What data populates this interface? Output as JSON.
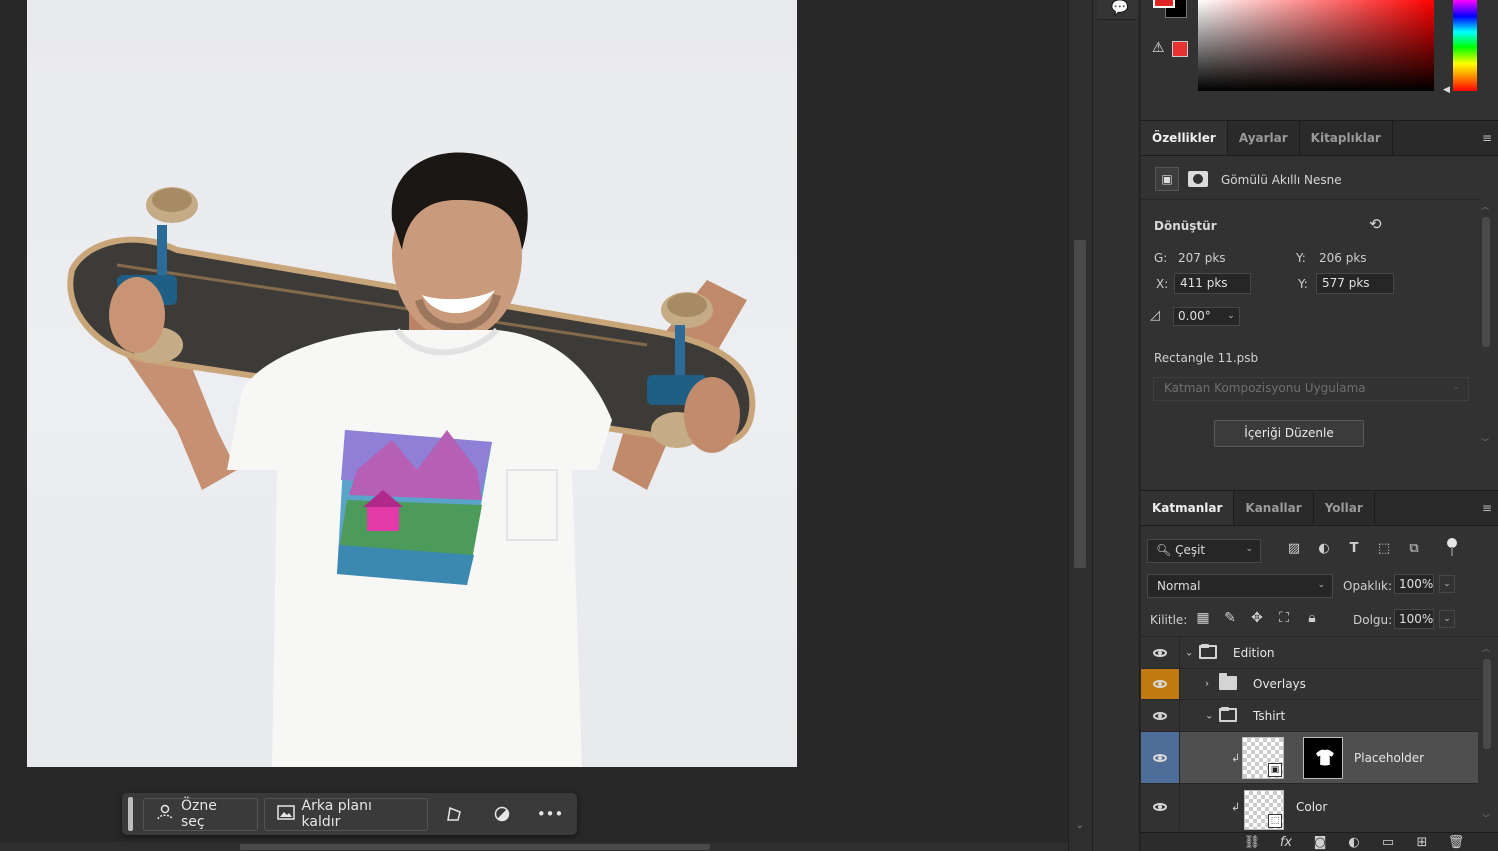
{
  "task_bar": {
    "select_subject": "Özne seç",
    "remove_background": "Arka planı kaldır"
  },
  "properties": {
    "tabs": [
      "Özellikler",
      "Ayarlar",
      "Kitaplıklar"
    ],
    "object_type": "Gömülü Akıllı Nesne",
    "transform_title": "Dönüştür",
    "width_label": "G:",
    "width_value": "207 pks",
    "height_label": "Y:",
    "height_value": "206 pks",
    "x_label": "X:",
    "x_value": "411 pks",
    "y_label": "Y:",
    "y_value": "577 pks",
    "angle_value": "0.00°",
    "file_name": "Rectangle 11.psb",
    "comp_placeholder": "Katman Kompozisyonu Uygulama",
    "edit_contents": "İçeriği Düzenle"
  },
  "layers": {
    "tabs": [
      "Katmanlar",
      "Kanallar",
      "Yollar"
    ],
    "kind_filter": "Çeşit",
    "blend_mode": "Normal",
    "opacity_label": "Opaklık:",
    "opacity_value": "100%",
    "lock_label": "Kilitle:",
    "fill_label": "Dolgu:",
    "fill_value": "100%",
    "rows": [
      {
        "name": "Edition",
        "kind": "group-open"
      },
      {
        "name": "Overlays",
        "kind": "group-closed"
      },
      {
        "name": "Tshirt",
        "kind": "group-open"
      },
      {
        "name": "Placeholder",
        "kind": "smart-object"
      },
      {
        "name": "Color",
        "kind": "layer"
      }
    ]
  },
  "colors": {
    "foreground": "#e02424",
    "background": "#000000",
    "accent_selected": "#4e6e99",
    "accent_orange": "#c17a12"
  }
}
